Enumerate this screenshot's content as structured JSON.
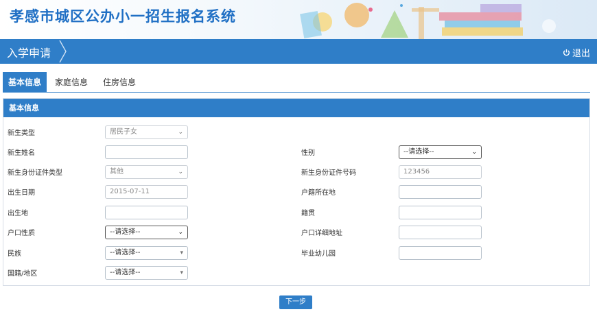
{
  "header": {
    "site_title": "孝感市城区公办小一招生报名系统"
  },
  "nav": {
    "title": "入学申请",
    "logout": "退出"
  },
  "tabs": [
    {
      "label": "基本信息",
      "active": true
    },
    {
      "label": "家庭信息",
      "active": false
    },
    {
      "label": "住房信息",
      "active": false
    }
  ],
  "panel": {
    "title": "基本信息"
  },
  "form": {
    "student_type": {
      "label": "新生类型",
      "value": "居民子女"
    },
    "student_name": {
      "label": "新生姓名",
      "value": ""
    },
    "gender": {
      "label": "性别",
      "value": "--请选择--"
    },
    "id_type": {
      "label": "新生身份证件类型",
      "value": "其他"
    },
    "id_number": {
      "label": "新生身份证件号码",
      "value": "123456"
    },
    "birth_date": {
      "label": "出生日期",
      "value": "2015-07-11"
    },
    "hukou_location": {
      "label": "户籍所在地",
      "value": ""
    },
    "birthplace": {
      "label": "出生地",
      "value": ""
    },
    "native_place": {
      "label": "籍贯",
      "value": ""
    },
    "hukou_nature": {
      "label": "户口性质",
      "value": "--请选择--"
    },
    "hukou_address": {
      "label": "户口详细地址",
      "value": ""
    },
    "ethnicity": {
      "label": "民族",
      "value": "--请选择--"
    },
    "kindergarten": {
      "label": "毕业幼儿园",
      "value": ""
    },
    "nationality": {
      "label": "国籍/地区",
      "value": "--请选择--"
    }
  },
  "next_button": "下一步",
  "colors": {
    "primary": "#2f7ec8",
    "title": "#1f6fc4"
  }
}
